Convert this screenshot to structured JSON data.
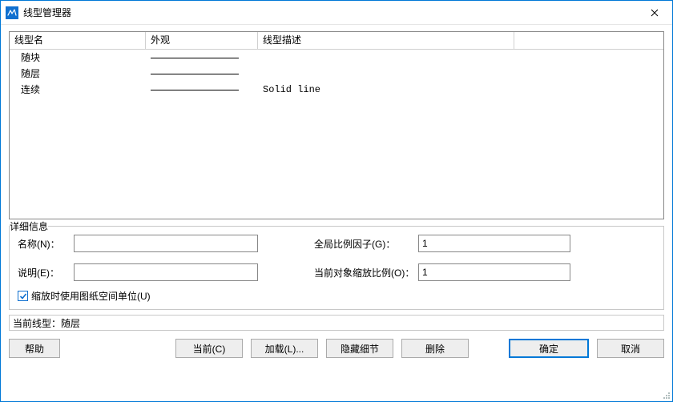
{
  "window": {
    "title": "线型管理器"
  },
  "columns": {
    "name": "线型名",
    "appearance": "外观",
    "description": "线型描述"
  },
  "rows": [
    {
      "name": "随块",
      "appearance": "line",
      "description": ""
    },
    {
      "name": "随层",
      "appearance": "line",
      "description": ""
    },
    {
      "name": "连续",
      "appearance": "line",
      "description": "Solid line"
    }
  ],
  "details": {
    "legend": "详细信息",
    "name_label": "名称(N)：",
    "name_value": "",
    "desc_label": "说明(E)：",
    "desc_value": "",
    "global_label": "全局比例因子(G)：",
    "global_value": "1",
    "current_label": "当前对象缩放比例(O)：",
    "current_value": "1",
    "paperspace_checked": true,
    "paperspace_label": "缩放时使用图纸空间单位(U)"
  },
  "status": {
    "label": "当前线型：",
    "value": "随层"
  },
  "buttons": {
    "help": "帮助",
    "current": "当前(C)",
    "load": "加载(L)...",
    "hide": "隐藏细节",
    "delete": "删除",
    "ok": "确定",
    "cancel": "取消"
  }
}
